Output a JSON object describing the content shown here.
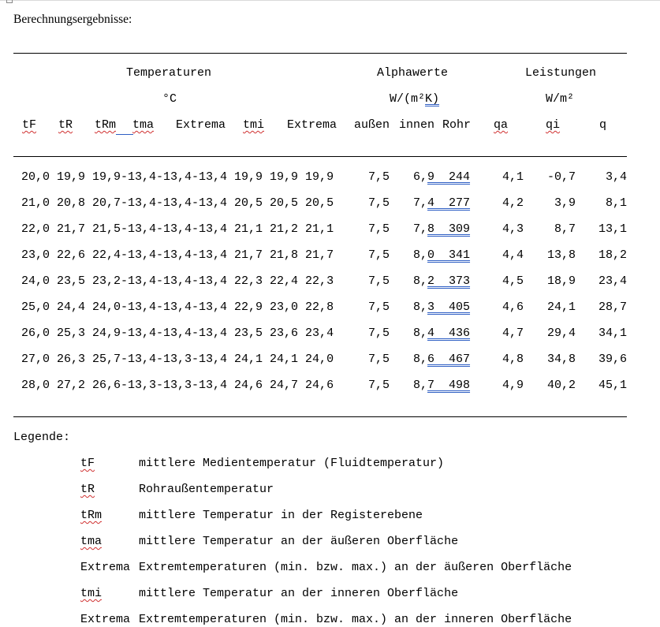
{
  "heading": "Berechnungsergebnisse:",
  "group_headers": {
    "temperaturen": "Temperaturen",
    "temperaturen_unit": "°C",
    "alphawerte": "Alphawerte",
    "alphawerte_unit_a": "W/(m²",
    "alphawerte_unit_b": "K)",
    "leistungen": "Leistungen",
    "leistungen_unit": "W/m²"
  },
  "columns": {
    "tF": "tF",
    "tR": "tR",
    "tRm": "tRm",
    "tma": "tma",
    "extrema1": "Extrema",
    "tmi": "tmi",
    "extrema2": "Extrema",
    "aussen": "außen",
    "innen": "innen",
    "rohr": "Rohr",
    "qa": "qa",
    "qi": "qi",
    "q": "q"
  },
  "rows": [
    {
      "a": "20,0 19,9 19,9-13,4-13,4-13,4 19,9 19,9 19,9",
      "out": "7,5",
      "in_a": "6,",
      "in_b": "9  244",
      "qa": "4,1",
      "qi": "-0,7",
      "q": "3,4"
    },
    {
      "a": "21,0 20,8 20,7-13,4-13,4-13,4 20,5 20,5 20,5",
      "out": "7,5",
      "in_a": "7,",
      "in_b": "4  277",
      "qa": "4,2",
      "qi": "3,9",
      "q": "8,1"
    },
    {
      "a": "22,0 21,7 21,5-13,4-13,4-13,4 21,1 21,2 21,1",
      "out": "7,5",
      "in_a": "7,",
      "in_b": "8  309",
      "qa": "4,3",
      "qi": "8,7",
      "q": "13,1"
    },
    {
      "a": "23,0 22,6 22,4-13,4-13,4-13,4 21,7 21,8 21,7",
      "out": "7,5",
      "in_a": "8,",
      "in_b": "0  341",
      "qa": "4,4",
      "qi": "13,8",
      "q": "18,2"
    },
    {
      "a": "24,0 23,5 23,2-13,4-13,4-13,4 22,3 22,4 22,3",
      "out": "7,5",
      "in_a": "8,",
      "in_b": "2  373",
      "qa": "4,5",
      "qi": "18,9",
      "q": "23,4"
    },
    {
      "a": "25,0 24,4 24,0-13,4-13,4-13,4 22,9 23,0 22,8",
      "out": "7,5",
      "in_a": "8,",
      "in_b": "3  405",
      "qa": "4,6",
      "qi": "24,1",
      "q": "28,7"
    },
    {
      "a": "26,0 25,3 24,9-13,4-13,4-13,4 23,5 23,6 23,4",
      "out": "7,5",
      "in_a": "8,",
      "in_b": "4  436",
      "qa": "4,7",
      "qi": "29,4",
      "q": "34,1"
    },
    {
      "a": "27,0 26,3 25,7-13,4-13,3-13,4 24,1 24,1 24,0",
      "out": "7,5",
      "in_a": "8,",
      "in_b": "6  467",
      "qa": "4,8",
      "qi": "34,8",
      "q": "39,6"
    },
    {
      "a": "28,0 27,2 26,6-13,3-13,3-13,4 24,6 24,7 24,6",
      "out": "7,5",
      "in_a": "8,",
      "in_b": "7  498",
      "qa": "4,9",
      "qi": "40,2",
      "q": "45,1"
    }
  ],
  "legend": {
    "label": "Legende:",
    "items": [
      {
        "term": "tF",
        "text": "mittlere Medientemperatur (Fluidtemperatur)"
      },
      {
        "term": "tR",
        "text": "Rohraußentemperatur"
      },
      {
        "term": "tRm",
        "text": "mittlere Temperatur in der Registerebene"
      },
      {
        "term": "tma",
        "text": "mittlere Temperatur an der äußeren Oberfläche"
      },
      {
        "term": "Extrema",
        "text": "Extremtemperaturen (min. bzw. max.) an der äußeren Oberfläche"
      },
      {
        "term": "tmi",
        "text": "mittlere Temperatur an der inneren Oberfläche"
      },
      {
        "term": "Extrema",
        "text": "Extremtemperaturen (min. bzw. max.) an der inneren Oberfläche"
      }
    ]
  }
}
